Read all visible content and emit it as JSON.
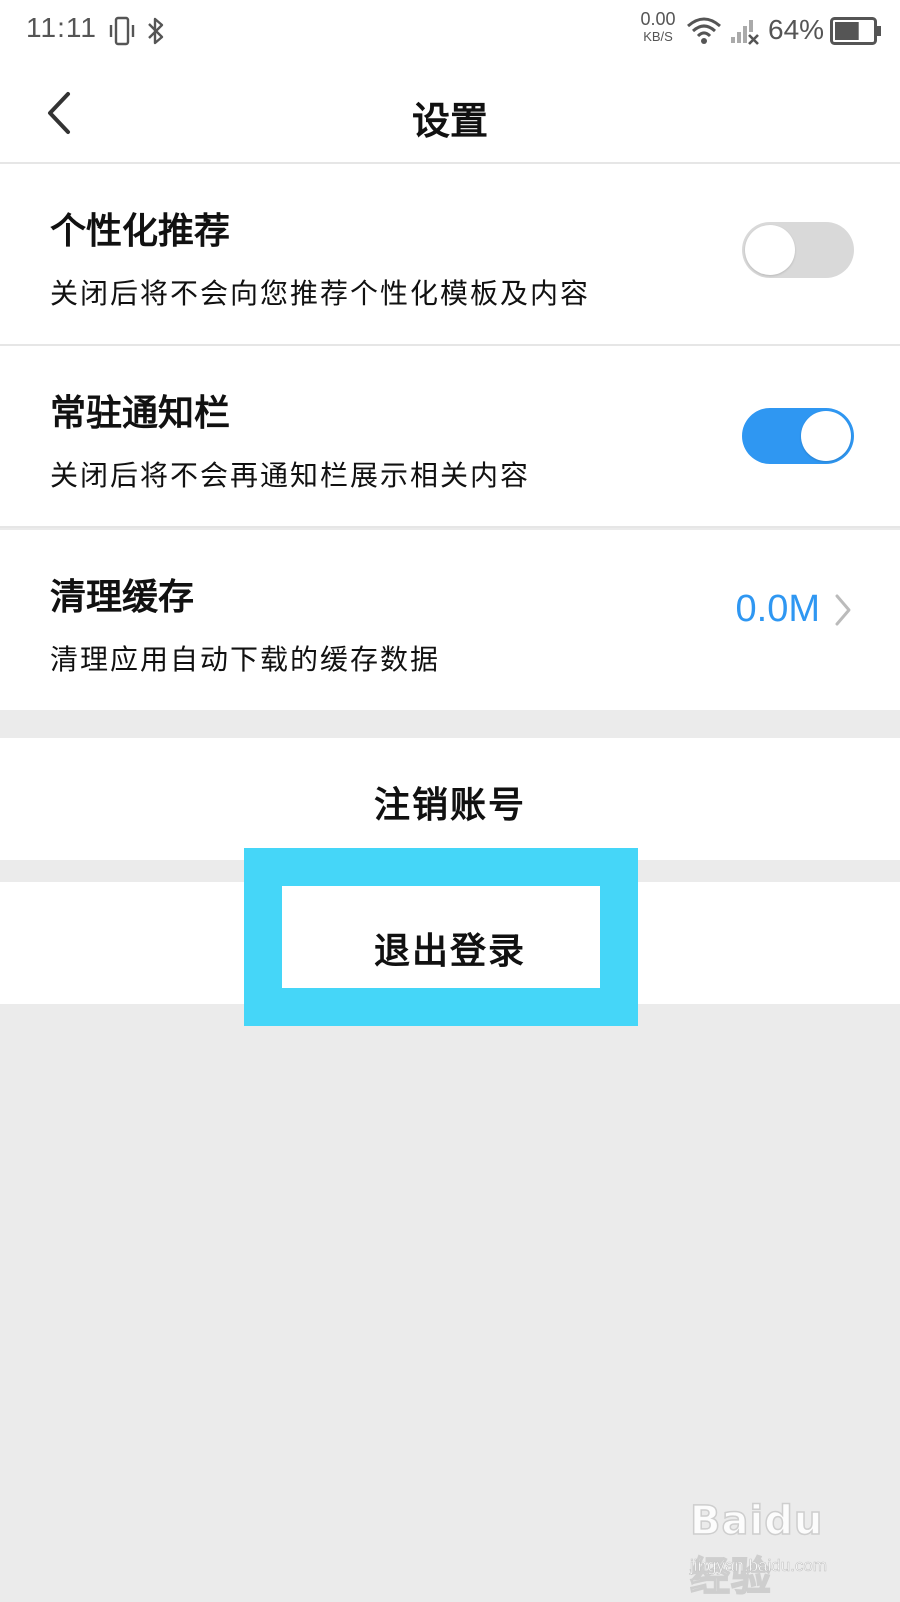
{
  "status_bar": {
    "time": "11:11",
    "net_speed_value": "0.00",
    "net_speed_unit": "KB/S",
    "battery_percent": "64%",
    "battery_level": 0.64,
    "icons": [
      "vibrate-icon",
      "bluetooth-icon",
      "wifi-icon",
      "no-signal-icon",
      "battery-icon"
    ]
  },
  "header": {
    "title": "设置",
    "back_icon": "chevron-left-icon"
  },
  "settings": [
    {
      "title": "个性化推荐",
      "description": "关闭后将不会向您推荐个性化模板及内容",
      "toggle_on": false
    },
    {
      "title": "常驻通知栏",
      "description": "关闭后将不会再通知栏展示相关内容",
      "toggle_on": true
    },
    {
      "title": "清理缓存",
      "description": "清理应用自动下载的缓存数据",
      "value": "0.0M",
      "icon": "chevron-right-icon"
    }
  ],
  "actions": {
    "deactivate_account": "注销账号",
    "logout": "退出登录"
  },
  "colors": {
    "accent": "#2f97f2",
    "highlight": "#45d6f8",
    "background": "#ebebeb"
  },
  "watermark": {
    "logo": "Baidu经验",
    "url": "jingyan.baidu.com"
  }
}
